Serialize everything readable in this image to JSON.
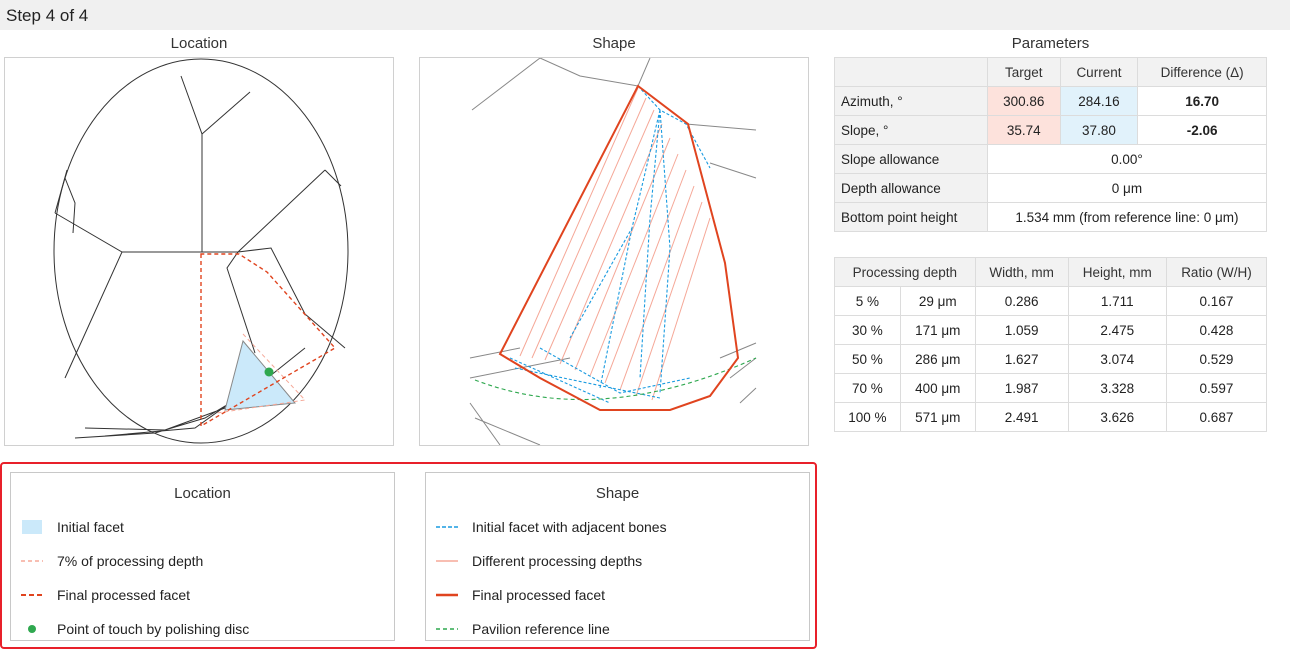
{
  "step": {
    "title": "Step 4 of 4"
  },
  "captions": {
    "location": "Location",
    "shape": "Shape",
    "parameters": "Parameters"
  },
  "parameters": {
    "headers": [
      "",
      "Target",
      "Current",
      "Difference (Δ)"
    ],
    "azimuth": {
      "label": "Azimuth, °",
      "target": "300.86",
      "current": "284.16",
      "difference": "16.70"
    },
    "slope": {
      "label": "Slope, °",
      "target": "35.74",
      "current": "37.80",
      "difference": "-2.06"
    },
    "slope_allowance": {
      "label": "Slope allowance",
      "value": "0.00°"
    },
    "depth_allowance": {
      "label": "Depth allowance",
      "value": "0 μm"
    },
    "bottom_point": {
      "label": "Bottom point height",
      "value": "1.534 mm (from reference line: 0 μm)"
    }
  },
  "depth_table": {
    "headers": {
      "processing_depth": "Processing depth",
      "width": "Width, mm",
      "height": "Height, mm",
      "ratio": "Ratio (W/H)"
    },
    "rows": [
      {
        "percent": "5 %",
        "depth": "29 μm",
        "width": "0.286",
        "height": "1.711",
        "ratio": "0.167"
      },
      {
        "percent": "30 %",
        "depth": "171 μm",
        "width": "1.059",
        "height": "2.475",
        "ratio": "0.428"
      },
      {
        "percent": "50 %",
        "depth": "286 μm",
        "width": "1.627",
        "height": "3.074",
        "ratio": "0.529"
      },
      {
        "percent": "70 %",
        "depth": "400 μm",
        "width": "1.987",
        "height": "3.328",
        "ratio": "0.597"
      },
      {
        "percent": "100 %",
        "depth": "571 μm",
        "width": "2.491",
        "height": "3.626",
        "ratio": "0.687"
      }
    ]
  },
  "legend": {
    "location": {
      "title": "Location",
      "items": {
        "initial_facet": "Initial facet",
        "processing_depth": "7% of processing depth",
        "final_facet": "Final processed facet",
        "touch_point": "Point of touch by polishing disc"
      }
    },
    "shape": {
      "title": "Shape",
      "items": {
        "initial_bones": "Initial facet with adjacent bones",
        "depths": "Different processing depths",
        "final_facet": "Final processed facet",
        "reference_line": "Pavilion reference line"
      }
    }
  },
  "colors": {
    "initial_facet_fill": "#cbe9fa",
    "blue_dashed": "#1a9be0",
    "light_red": "#f5a898",
    "red": "#e0441f",
    "green": "#2fa84f",
    "gray_line": "#888888",
    "highlight_frame": "#e8202a"
  }
}
